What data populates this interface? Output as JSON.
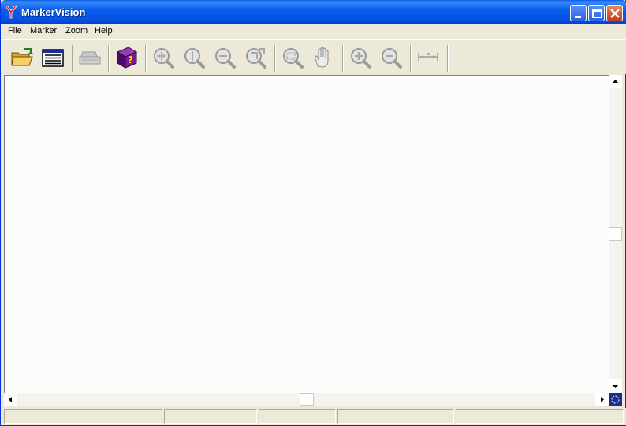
{
  "window": {
    "title": "MarkerVision"
  },
  "menu": [
    {
      "label": "File"
    },
    {
      "label": "Marker"
    },
    {
      "label": "Zoom"
    },
    {
      "label": "Help"
    }
  ],
  "toolbar": {
    "tools": [
      {
        "icon": "open-folder-icon",
        "enabled": true
      },
      {
        "icon": "list-view-icon",
        "enabled": true
      },
      {
        "icon": "print-icon",
        "enabled": false
      },
      {
        "icon": "help-book-icon",
        "enabled": true
      },
      {
        "icon": "zoom-in-icon",
        "enabled": false
      },
      {
        "icon": "zoom-fit-icon",
        "enabled": false
      },
      {
        "icon": "zoom-out-icon",
        "enabled": false
      },
      {
        "icon": "zoom-previous-icon",
        "enabled": false
      },
      {
        "icon": "zoom-window-icon",
        "enabled": false
      },
      {
        "icon": "pan-hand-icon",
        "enabled": false
      },
      {
        "icon": "zoom-in-plus-icon",
        "enabled": false
      },
      {
        "icon": "zoom-out-minus-icon",
        "enabled": false
      },
      {
        "icon": "measure-icon",
        "enabled": false
      }
    ]
  },
  "colors": {
    "titlebar": "#0a5fef",
    "book": "#6a1a8a",
    "question": "#ffd800"
  },
  "statusbar": {
    "panels": [
      "",
      "",
      "",
      "",
      ""
    ]
  }
}
